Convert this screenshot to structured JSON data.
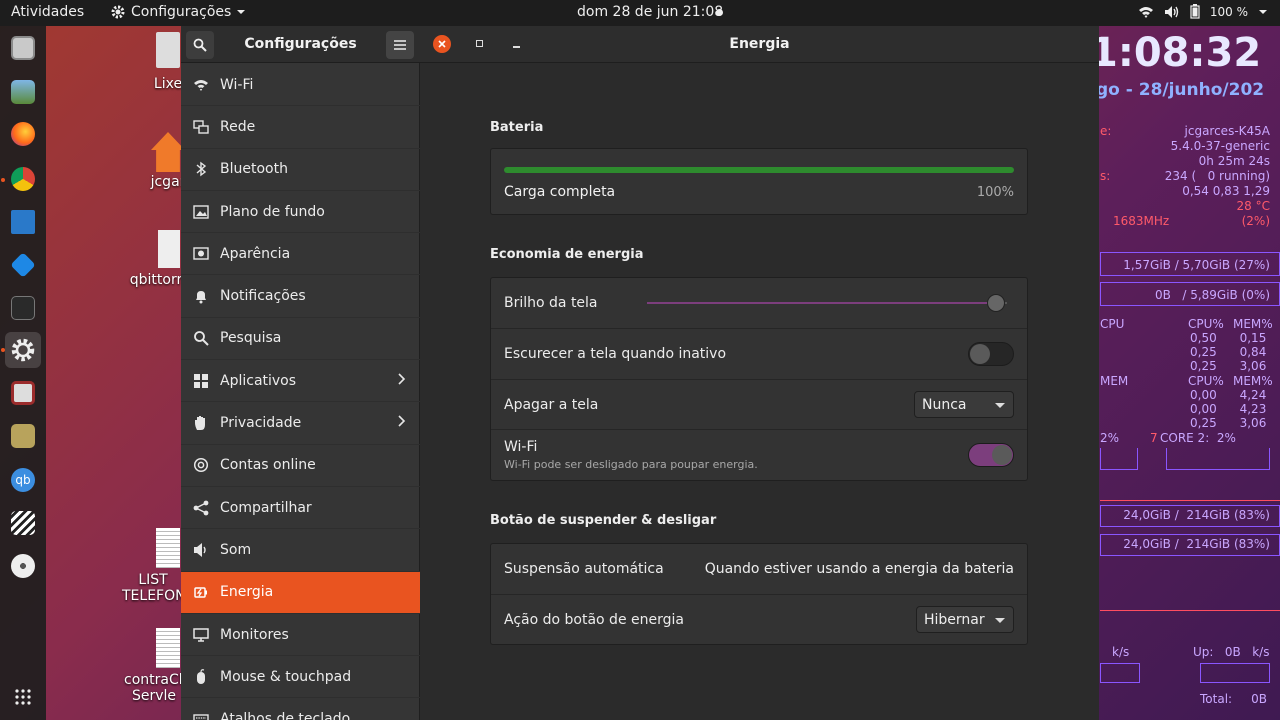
{
  "topbar": {
    "activities": "Atividades",
    "app_menu": "Configurações",
    "clock": "dom 28 de jun  21:08",
    "battery": "100 %"
  },
  "desktop": {
    "items": [
      {
        "label": "Lixe"
      },
      {
        "label": "jcgar"
      },
      {
        "label": "qbittorr"
      },
      {
        "label": "LIST\nTELEFON"
      },
      {
        "label": "contraCh\nServle"
      }
    ]
  },
  "conky": {
    "time": "1:08:32",
    "date": "go - 28/junho/202",
    "host": "jcgarces-K45A",
    "kernel": "5.4.0-37-generic",
    "uptime": "0h 25m 24s",
    "procs": "234 (   0 running)",
    "load": "0,54 0,83 1,29",
    "temp": "28 °C",
    "freq": "1683MHz",
    "cpu_pct": "(2%)",
    "ram": "1,57GiB / 5,70GiB (27%)",
    "swap": "0B   / 5,89GiB (0%)",
    "cpu_header": "CPU",
    "mem_header": "MEM",
    "col_cpu": "CPU%",
    "col_mem": "MEM%",
    "cpu_rows": [
      "0,50      0,15",
      "0,25      0,84",
      "0,25      3,06"
    ],
    "mem_rows": [
      "0,00      4,24",
      "0,00      4,23",
      "0,25      3,06"
    ],
    "core_left": "2%",
    "core2_num": "7",
    "core2": "CORE 2:  2%",
    "disk1": "24,0GiB /  214GiB (83%)",
    "disk2": "24,0GiB /  214GiB (83%)",
    "down_unit": "k/s",
    "up_label": "Up:   0B   k/s",
    "total": "Total:     0B"
  },
  "window": {
    "sidebar_title": "Configurações",
    "title": "Energia",
    "sidebar": [
      {
        "label": "Wi-Fi",
        "icon": "wifi-icon",
        "chevron": false
      },
      {
        "label": "Rede",
        "icon": "network-icon",
        "chevron": false
      },
      {
        "label": "Bluetooth",
        "icon": "bluetooth-icon",
        "chevron": false
      },
      {
        "label": "Plano de fundo",
        "icon": "background-icon",
        "chevron": false
      },
      {
        "label": "Aparência",
        "icon": "appearance-icon",
        "chevron": false
      },
      {
        "label": "Notificações",
        "icon": "bell-icon",
        "chevron": false
      },
      {
        "label": "Pesquisa",
        "icon": "search-icon",
        "chevron": false
      },
      {
        "label": "Aplicativos",
        "icon": "apps-icon",
        "chevron": true
      },
      {
        "label": "Privacidade",
        "icon": "hand-icon",
        "chevron": true
      },
      {
        "label": "Contas online",
        "icon": "at-icon",
        "chevron": false
      },
      {
        "label": "Compartilhar",
        "icon": "share-icon",
        "chevron": false
      },
      {
        "label": "Som",
        "icon": "speaker-icon",
        "chevron": false
      },
      {
        "label": "Energia",
        "icon": "power-icon",
        "chevron": false,
        "active": true
      },
      {
        "label": "Monitores",
        "icon": "monitor-icon",
        "chevron": false
      },
      {
        "label": "Mouse & touchpad",
        "icon": "mouse-icon",
        "chevron": false
      },
      {
        "label": "Atalhos de teclado",
        "icon": "keyboard-icon",
        "chevron": false
      }
    ]
  },
  "battery": {
    "section": "Bateria",
    "status": "Carga completa",
    "percent": "100%",
    "level": 1.0
  },
  "power_saving": {
    "section": "Economia de energia",
    "brightness_label": "Brilho da tela",
    "brightness_level": 0.97,
    "dim_label": "Escurecer a tela quando inativo",
    "dim_on": false,
    "blank_label": "Apagar a tela",
    "blank_value": "Nunca",
    "wifi_label": "Wi-Fi",
    "wifi_sub": "Wi-Fi pode ser desligado para poupar energia.",
    "wifi_on": true
  },
  "suspend": {
    "section": "Botão de suspender & desligar",
    "auto_label": "Suspensão automática",
    "auto_value": "Quando estiver usando a energia da bateria",
    "power_button_label": "Ação do botão de energia",
    "power_button_value": "Hibernar"
  },
  "colors": {
    "accent": "#e95420",
    "battery_fill": "#2e8b2e",
    "switch_on": "#7c3e7d"
  }
}
